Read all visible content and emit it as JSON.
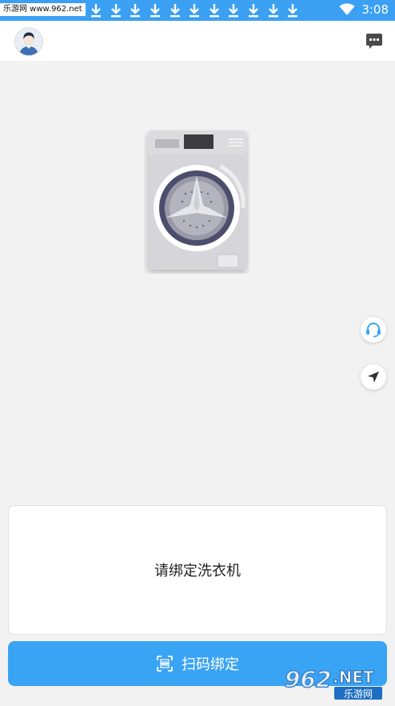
{
  "status_bar": {
    "watermark": "乐游网 www.962.net",
    "time": "3:08",
    "download_icon_count": 11,
    "bg_color": "#3ba0f2"
  },
  "header": {
    "avatar_icon": "user-avatar",
    "message_icon": "chat-bubble-icon"
  },
  "illustration": {
    "icon": "washing-machine"
  },
  "float_buttons": [
    {
      "icon": "headset-icon"
    },
    {
      "icon": "location-arrow-icon"
    }
  ],
  "card": {
    "text": "请绑定洗衣机"
  },
  "scan_button": {
    "label": "扫码绑定",
    "icon": "scan-icon",
    "color": "#3aa4f4"
  },
  "corner_logo": {
    "text_big": "962",
    "text_net": ".NET",
    "text_cn": "乐游网"
  }
}
